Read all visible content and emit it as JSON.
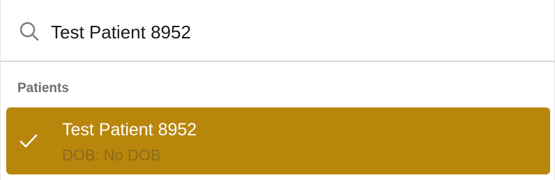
{
  "search": {
    "value": "Test Patient 8952",
    "icon": "search-icon"
  },
  "group": {
    "label": "Patients"
  },
  "results": [
    {
      "name": "Test Patient 8952",
      "dob_label": "DOB:",
      "dob_value": "No DOB",
      "selected": true,
      "icon": "checkmark-icon"
    }
  ],
  "colors": {
    "selected_background": "#b8860b",
    "selected_text": "#ffffff",
    "secondary_text": "#8a6a1e",
    "group_label": "#6f6f6f"
  }
}
